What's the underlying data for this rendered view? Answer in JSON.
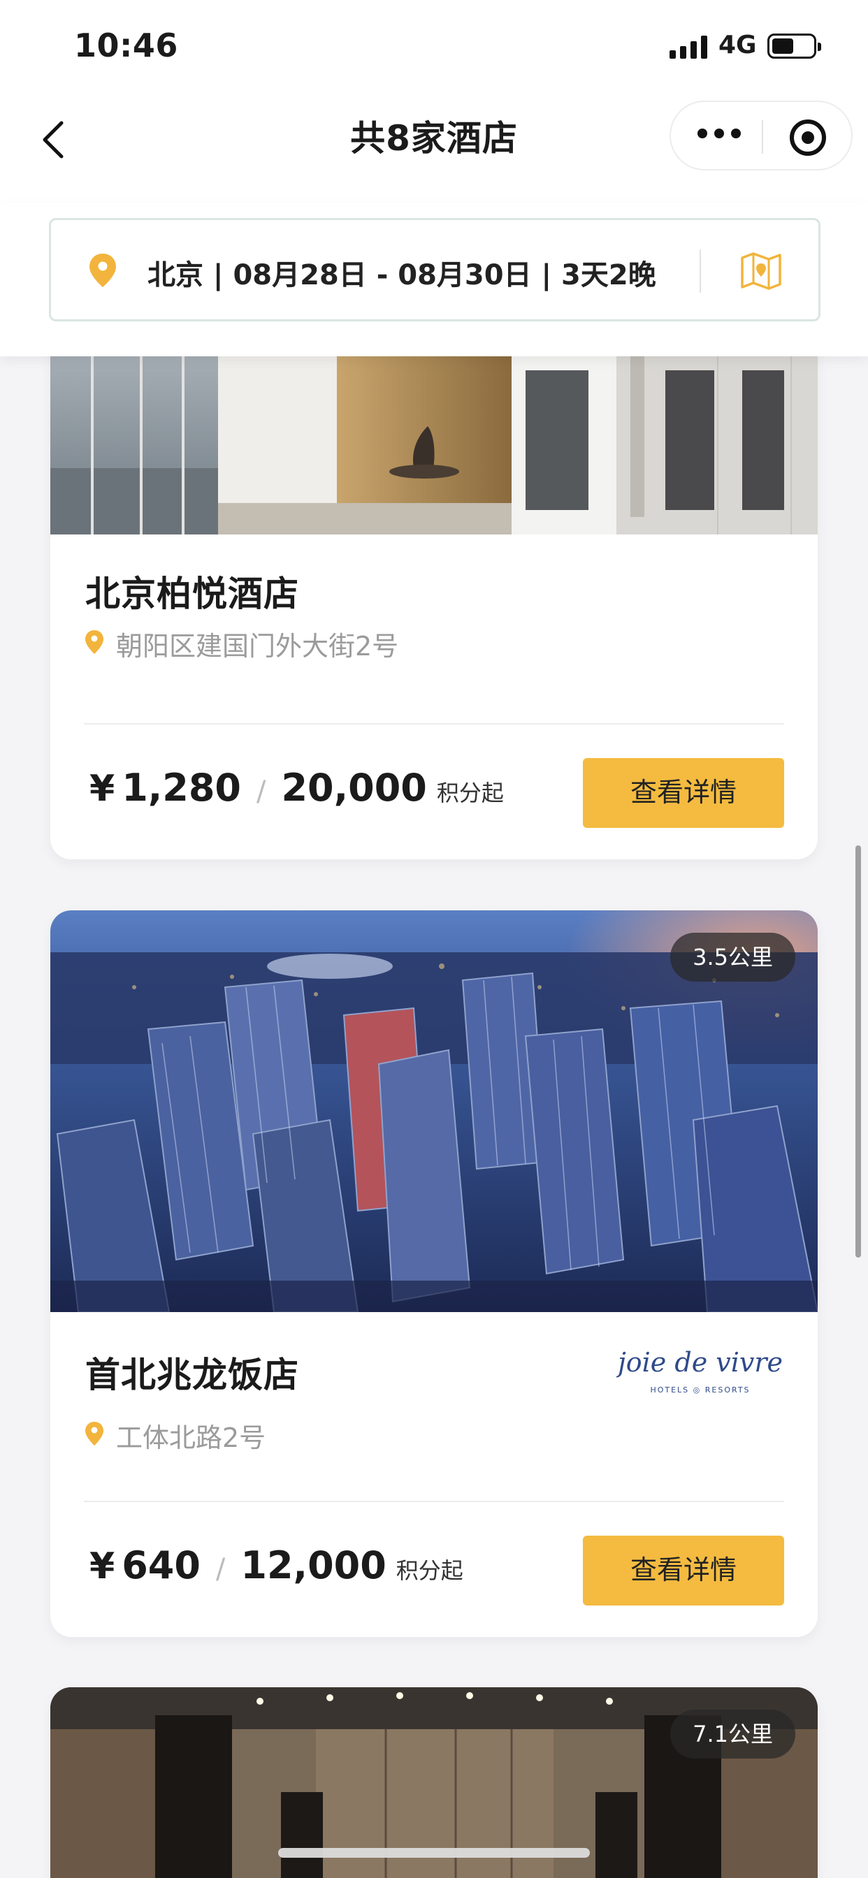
{
  "status_bar": {
    "time": "10:46",
    "network": "4G"
  },
  "nav": {
    "title": "共8家酒店"
  },
  "search": {
    "summary": "北京 | 08月28日 - 08月30日 | 3天2晚"
  },
  "colors": {
    "accent": "#f4bb40",
    "pin": "#f2b43c",
    "text_muted": "#9b9b9b"
  },
  "hotels": [
    {
      "name": "北京柏悦酒店",
      "address": "朝阳区建国门外大街2号",
      "currency": "¥",
      "price": "1,280",
      "points": "20,000",
      "points_unit": "积分起",
      "button": "查看详情"
    },
    {
      "name": "首北兆龙饭店",
      "address": "工体北路2号",
      "distance": "3.5公里",
      "brand": "joie de vivre",
      "brand_sub": "HOTELS ◎ RESORTS",
      "currency": "¥",
      "price": "640",
      "points": "12,000",
      "points_unit": "积分起",
      "button": "查看详情"
    },
    {
      "distance": "7.1公里"
    }
  ]
}
